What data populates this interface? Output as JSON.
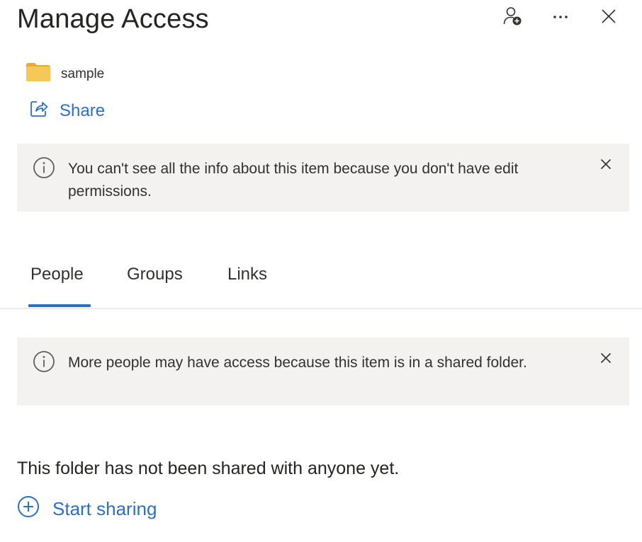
{
  "panel": {
    "title": "Manage Access"
  },
  "header": {
    "icons": [
      "add-person-icon",
      "more-icon",
      "close-icon"
    ]
  },
  "item": {
    "name": "sample",
    "icon": "folder-icon",
    "folder_color": "#f2c14e"
  },
  "share": {
    "label": "Share",
    "icon": "share-icon"
  },
  "banners": [
    {
      "text": "You can't see all the info about this item because you don't have edit permissions.",
      "icon": "info-icon"
    },
    {
      "text": "More people may have access because this item is in a shared folder.",
      "icon": "info-icon"
    }
  ],
  "tabs": [
    {
      "label": "People",
      "selected": true
    },
    {
      "label": "Groups",
      "selected": false
    },
    {
      "label": "Links",
      "selected": false
    }
  ],
  "people": {
    "empty_message": "This folder has not been shared with anyone yet.",
    "start_sharing_label": "Start sharing"
  },
  "colors": {
    "accent": "#2b6fc6",
    "banner_bg": "#f3f2f1",
    "text": "#252423"
  }
}
